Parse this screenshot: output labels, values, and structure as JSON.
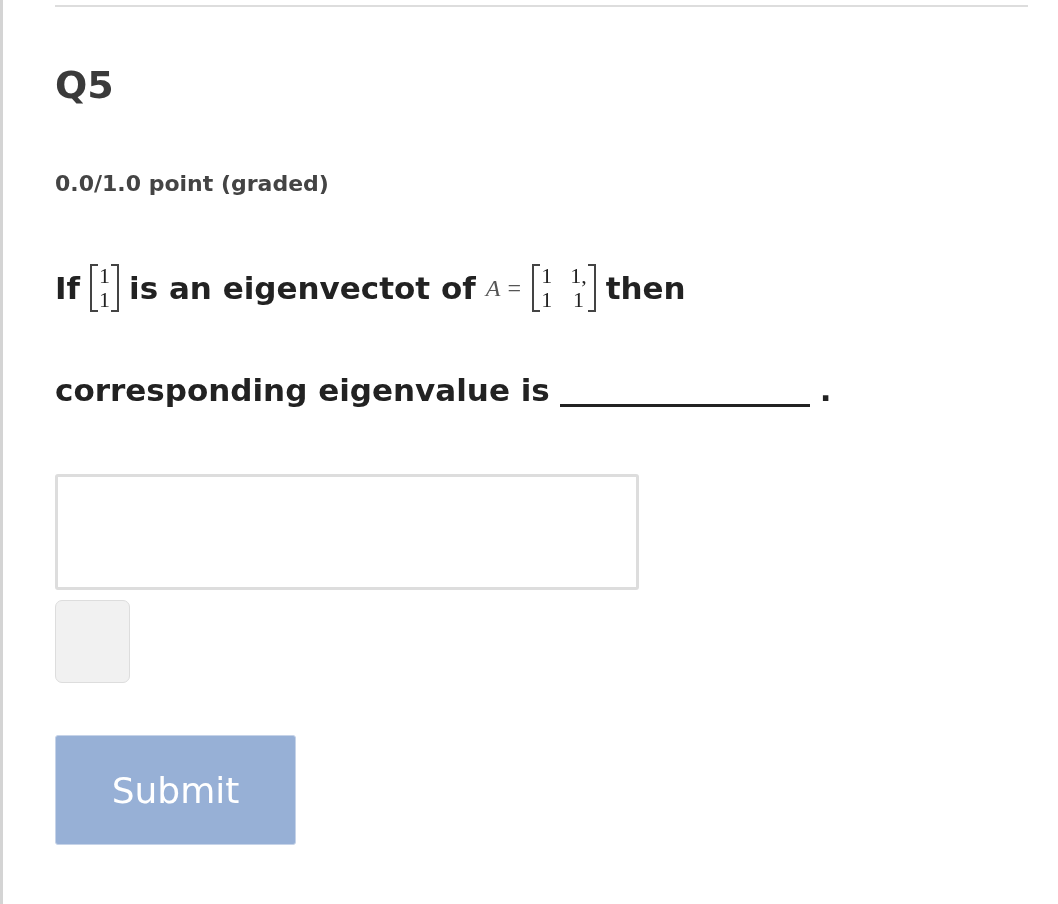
{
  "problem": {
    "title": "Q5",
    "points": "0.0/1.0 point (graded)",
    "question": [
      {
        "kind": "text",
        "text": "If"
      },
      {
        "kind": "matrix",
        "rows": [
          [
            "1"
          ],
          [
            "1"
          ]
        ]
      },
      {
        "kind": "text",
        "text": "is an eigenvectot of"
      },
      {
        "kind": "math",
        "text": "A ="
      },
      {
        "kind": "matrix",
        "rows": [
          [
            "1",
            "1,"
          ],
          [
            "1",
            "1"
          ]
        ]
      },
      {
        "kind": "text",
        "text": "then"
      },
      {
        "kind": "break"
      },
      {
        "kind": "text",
        "text": "corresponding eigenvalue is"
      },
      {
        "kind": "blank"
      },
      {
        "kind": "text",
        "text": "."
      }
    ],
    "answer": {
      "kind": "input"
    },
    "status": {
      "kind": "indicator"
    },
    "submit": {
      "label": "Submit",
      "disabled": true
    }
  }
}
